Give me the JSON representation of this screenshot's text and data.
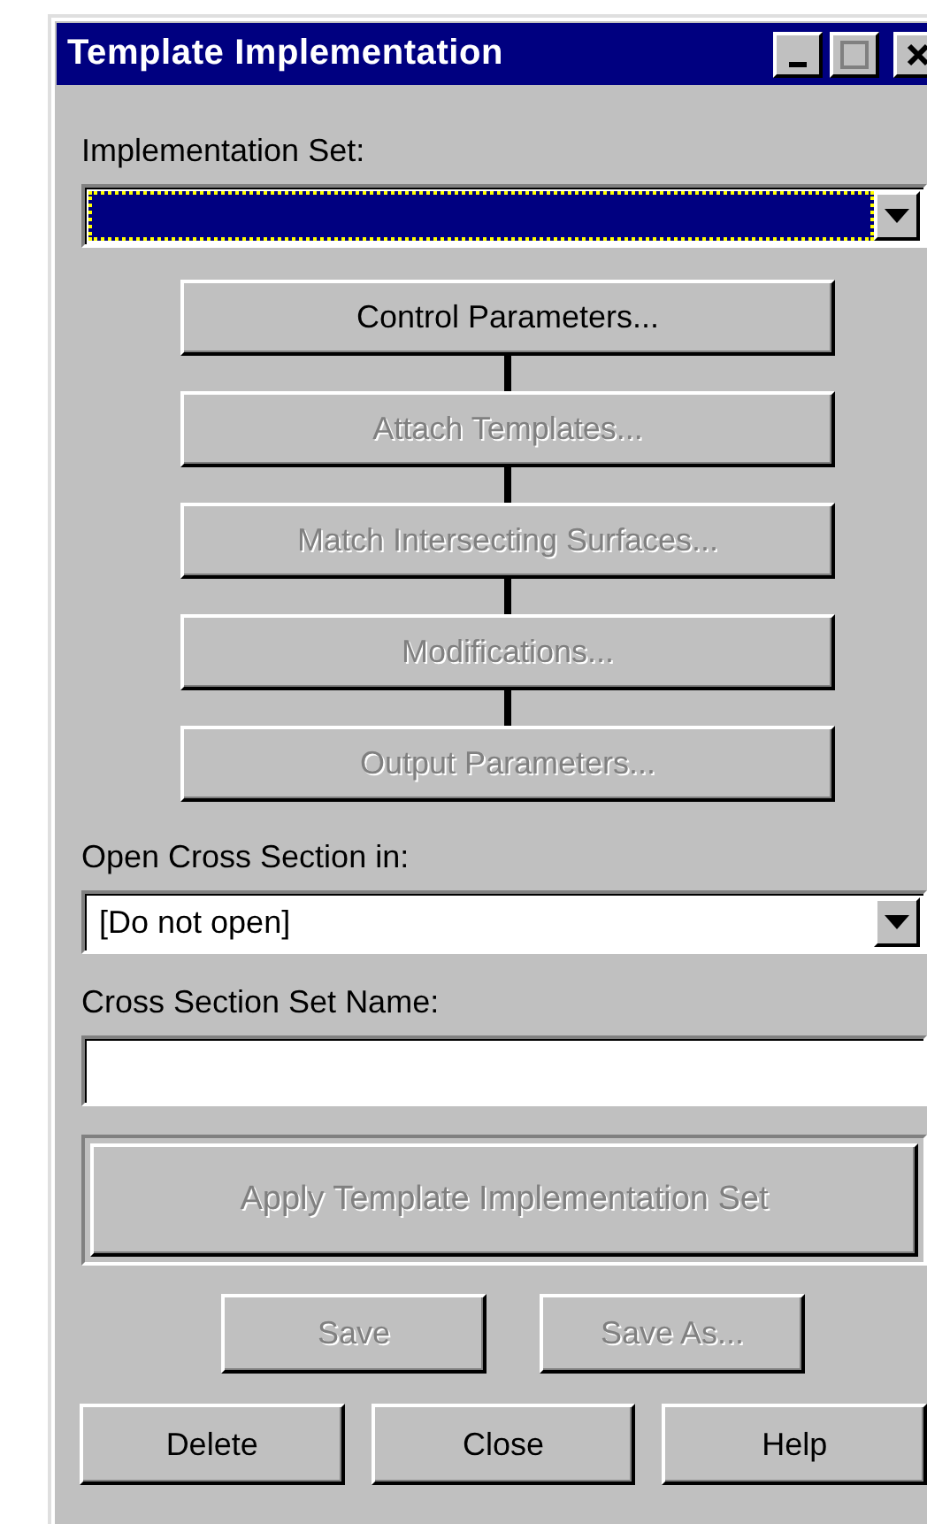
{
  "window": {
    "title": "Template Implementation"
  },
  "implementation_set": {
    "label": "Implementation Set:",
    "focused": true
  },
  "steps": [
    {
      "label": "Control Parameters...",
      "disabled": false
    },
    {
      "label": "Attach Templates...",
      "disabled": true
    },
    {
      "label": "Match Intersecting Surfaces...",
      "disabled": true
    },
    {
      "label": "Modifications...",
      "disabled": true
    },
    {
      "label": "Output Parameters...",
      "disabled": true
    }
  ],
  "open_cross_section": {
    "label": "Open Cross Section in:",
    "value": "[Do not open]"
  },
  "cross_section_set_name": {
    "label": "Cross Section Set Name:"
  },
  "apply_button": {
    "label": "Apply Template Implementation Set",
    "disabled": true
  },
  "save_buttons": [
    {
      "label": "Save",
      "disabled": true
    },
    {
      "label": "Save As...",
      "disabled": true
    }
  ],
  "footer_buttons": [
    {
      "label": "Delete",
      "disabled": false
    },
    {
      "label": "Close",
      "disabled": false
    },
    {
      "label": "Help",
      "disabled": false
    }
  ]
}
